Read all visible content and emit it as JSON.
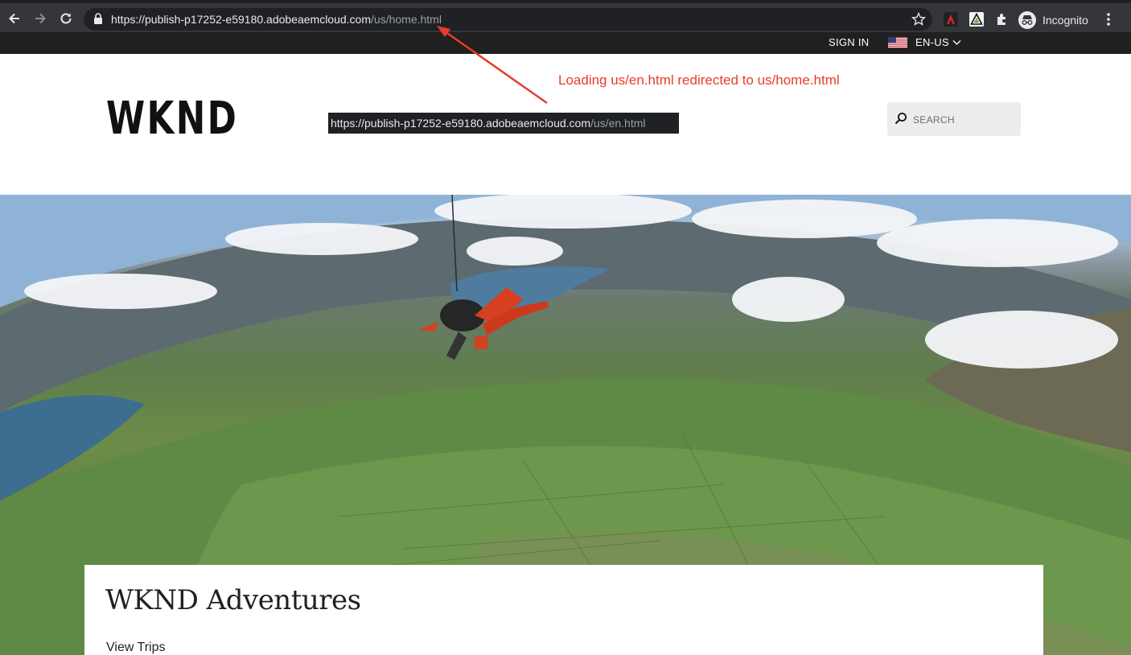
{
  "browser": {
    "url_host": "https://publish-p17252-e59180.adobeaemcloud.com",
    "url_path": "/us/home.html",
    "profile_label": "Incognito",
    "icons": [
      "back-icon",
      "forward-icon",
      "reload-icon",
      "lock-icon",
      "star-icon",
      "acrobat-extension-icon",
      "adobe-extension-icon",
      "puzzle-extension-icon",
      "incognito-icon",
      "more-menu-icon"
    ]
  },
  "site": {
    "topbar": {
      "sign_in": "SIGN IN",
      "language": "EN-US"
    },
    "logo": "WKND",
    "search": {
      "placeholder": "SEARCH"
    }
  },
  "annotation": {
    "text": "Loading us/en.html redirected to us/home.html",
    "tooltip_host": "https://publish-p17252-e59180.adobeaemcloud.com",
    "tooltip_path": "/us/en.html",
    "color": "#ea3b2c"
  },
  "hero": {
    "image": "skydiver-aerial-landscape"
  },
  "card": {
    "title": "WKND Adventures",
    "link": "View Trips"
  }
}
